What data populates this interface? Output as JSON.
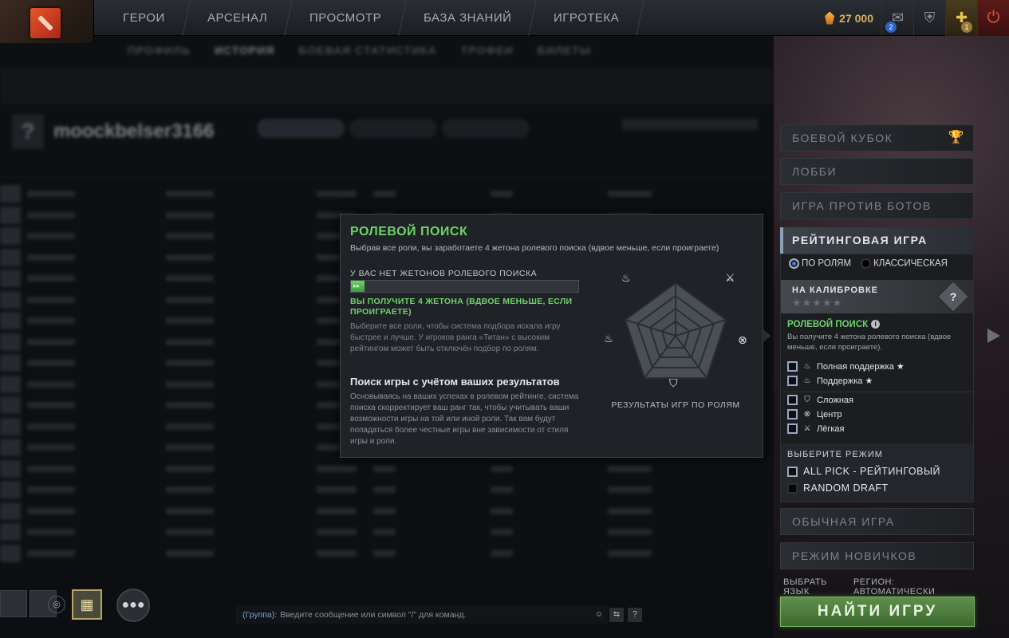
{
  "topnav": {
    "items": [
      "ГЕРОИ",
      "АРСЕНАЛ",
      "ПРОСМОТР",
      "БАЗА ЗНАНИЙ",
      "ИГРОТЕКА"
    ],
    "shards": "27 000",
    "mail_badge": "2",
    "plus_badge": "1",
    "icons": [
      "dota-logo-icon",
      "shard-icon",
      "mail-icon",
      "armory-icon",
      "plus-icon",
      "power-icon"
    ]
  },
  "profile": {
    "subnav": [
      "ПРОФИЛЬ",
      "ИСТОРИЯ",
      "БОЕВАЯ СТАТИСТИКА",
      "ТРОФЕИ",
      "БИЛЕТЫ"
    ],
    "username": "moockbelser3166"
  },
  "popup": {
    "title": "РОЛЕВОЙ ПОИСК",
    "subtitle": "Выбрав все роли, вы заработаете 4 жетона ролевого поиска (вдвое меньше, если проиграете)",
    "tokens_header": "У ВАС НЕТ ЖЕТОНОВ РОЛЕВОГО ПОИСКА",
    "tokens_progress": 0.06,
    "progress_arrows": "▸▸",
    "get_tokens": "ВЫ ПОЛУЧИТЕ 4 ЖЕТОНА (ВДВОЕ МЕНЬШЕ, ЕСЛИ ПРОИГРАЕТЕ)",
    "desc1": "Выберите все роли, чтобы система подбора искала игру быстрее и лучше. У игроков ранга «Титан» с высоким рейтингом может быть отключён подбор по ролям.",
    "heading2": "Поиск игры с учётом ваших результатов",
    "desc2": "Основываясь на ваших успехах в ролевом рейтинге, система поиска скорректирует ваш ранг так, чтобы учитывать ваши возможности игры на той или иной роли. Так вам будут попадаться более честные игры вне зависимости от стиля игры и роли.",
    "radar_caption": "РЕЗУЛЬТАТЫ ИГР ПО РОЛЯМ"
  },
  "right_panel": {
    "battle_cup": "БОЕВОЙ КУБОК",
    "lobby": "ЛОББИ",
    "bots": "ИГРА ПРОТИВ БОТОВ",
    "ranked": "РЕЙТИНГОВАЯ ИГРА",
    "by_roles": "ПО РОЛЯМ",
    "classic": "КЛАССИЧЕСКАЯ",
    "calibration": "НА КАЛИБРОВКЕ",
    "calibration_stars": "★★★★★",
    "role_search_title": "РОЛЕВОЙ ПОИСК",
    "role_search_desc": "Вы получите 4 жетона ролевого поиска (вдвое меньше, если проиграете).",
    "roles": [
      {
        "label": "Полная поддержка ★",
        "icon": "hard-support-icon",
        "glyph": "♨"
      },
      {
        "label": "Поддержка ★",
        "icon": "soft-support-icon",
        "glyph": "♨"
      },
      {
        "label": "Сложная",
        "icon": "offlane-icon",
        "glyph": "⛉"
      },
      {
        "label": "Центр",
        "icon": "mid-icon",
        "glyph": "⊗"
      },
      {
        "label": "Лёгкая",
        "icon": "safelane-icon",
        "glyph": "⚔"
      }
    ],
    "choose_mode": "ВЫБЕРИТЕ РЕЖИМ",
    "modes": [
      "ALL PICK - РЕЙТИНГОВЫЙ",
      "RANDOM DRAFT"
    ],
    "normal": "ОБЫЧНАЯ ИГРА",
    "newbie": "РЕЖИМ НОВИЧКОВ",
    "language": "ВЫБРАТЬ ЯЗЫК",
    "region": "РЕГИОН: АВТОМАТИЧЕСКИ",
    "find_game": "НАЙТИ ИГРУ"
  },
  "chat": {
    "group_label": "(Группа):",
    "placeholder": "Введите сообщение или символ \"/\" для команд."
  },
  "colors": {
    "accent_green": "#6fd36a",
    "find_button": "#4f7d3f",
    "background": "#0d0f12"
  }
}
